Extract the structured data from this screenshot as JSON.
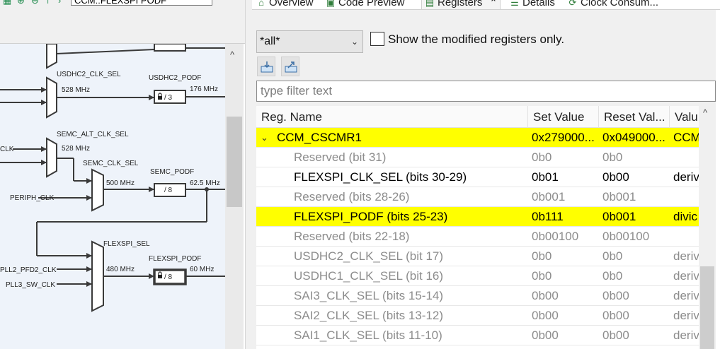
{
  "left_panel": {
    "search_value": "CCM::FLEXSPI PODF",
    "diagram": {
      "labels": {
        "usdhc2_clk_sel": "USDHC2_CLK_SEL",
        "usdhc2_mux_freq": "528 MHz",
        "usdhc2_podf": "USDHC2_PODF",
        "usdhc2_podf_value": "/ 3",
        "usdhc2_out_freq": "176 MHz",
        "semc_alt_clk_sel": "SEMC_ALT_CLK_SEL",
        "clk_input": "CLK",
        "semc_alt_freq": "528 MHz",
        "semc_clk_sel": "SEMC_CLK_SEL",
        "semc_mux_freq": "500 MHz",
        "semc_podf": "SEMC_PODF",
        "semc_podf_value": "/ 8",
        "semc_out_freq": "62.5 MHz",
        "periph_clk": "PERIPH_CLK",
        "flexspi_sel": "FLEXSPI_SEL",
        "flexspi_podf": "FLEXSPI_PODF",
        "flexspi_mux_freq": "480 MHz",
        "flexspi_podf_value": "/ 8",
        "flexspi_out_freq": "60 MHz",
        "pll2_pfd2_clk": "PLL2_PFD2_CLK",
        "pll3_sw_clk": "PLL3_SW_CLK"
      }
    }
  },
  "tabs": [
    {
      "label": "Overview",
      "icon": "home-icon"
    },
    {
      "label": "Code Preview",
      "icon": "code-preview-icon"
    },
    {
      "label": "Registers",
      "icon": "registers-icon",
      "active": true
    },
    {
      "label": "Details",
      "icon": "list-icon"
    },
    {
      "label": "Clock Consum...",
      "icon": "clock-consumers-icon"
    }
  ],
  "registers": {
    "scope_value": "*all*",
    "modified_only_label": "Show the modified registers only.",
    "modified_only_checked": false,
    "filter_placeholder": "type filter text",
    "columns": [
      "Reg. Name",
      "Set Value",
      "Reset Val...",
      "Valu"
    ],
    "highlight_color": "#ffff00",
    "rows": [
      {
        "name": "CCM_CSCMR1",
        "set": "0x279000...",
        "reset": "0x049000...",
        "value": "CCM",
        "highlight": true,
        "expanded": true,
        "level": 0,
        "dim": false
      },
      {
        "name": "Reserved (bit 31)",
        "set": "0b0",
        "reset": "0b0",
        "value": "",
        "highlight": false,
        "level": 1,
        "dim": true
      },
      {
        "name": "FLEXSPI_CLK_SEL (bits 30-29)",
        "set": "0b01",
        "reset": "0b00",
        "value": "deriv",
        "highlight": false,
        "level": 1,
        "dim": false
      },
      {
        "name": "Reserved (bits 28-26)",
        "set": "0b001",
        "reset": "0b001",
        "value": "",
        "highlight": false,
        "level": 1,
        "dim": true
      },
      {
        "name": "FLEXSPI_PODF (bits 25-23)",
        "set": "0b111",
        "reset": "0b001",
        "value": "divic",
        "highlight": true,
        "level": 1,
        "dim": false
      },
      {
        "name": "Reserved (bits 22-18)",
        "set": "0b00100",
        "reset": "0b00100",
        "value": "",
        "highlight": false,
        "level": 1,
        "dim": true
      },
      {
        "name": "USDHC2_CLK_SEL (bit 17)",
        "set": "0b0",
        "reset": "0b0",
        "value": "deriv",
        "highlight": false,
        "level": 1,
        "dim": true
      },
      {
        "name": "USDHC1_CLK_SEL (bit 16)",
        "set": "0b0",
        "reset": "0b0",
        "value": "deriv",
        "highlight": false,
        "level": 1,
        "dim": true
      },
      {
        "name": "SAI3_CLK_SEL (bits 15-14)",
        "set": "0b00",
        "reset": "0b00",
        "value": "deriv",
        "highlight": false,
        "level": 1,
        "dim": true
      },
      {
        "name": "SAI2_CLK_SEL (bits 13-12)",
        "set": "0b00",
        "reset": "0b00",
        "value": "deriv",
        "highlight": false,
        "level": 1,
        "dim": true
      },
      {
        "name": "SAI1_CLK_SEL (bits 11-10)",
        "set": "0b00",
        "reset": "0b00",
        "value": "deriv",
        "highlight": false,
        "level": 1,
        "dim": true
      }
    ]
  }
}
